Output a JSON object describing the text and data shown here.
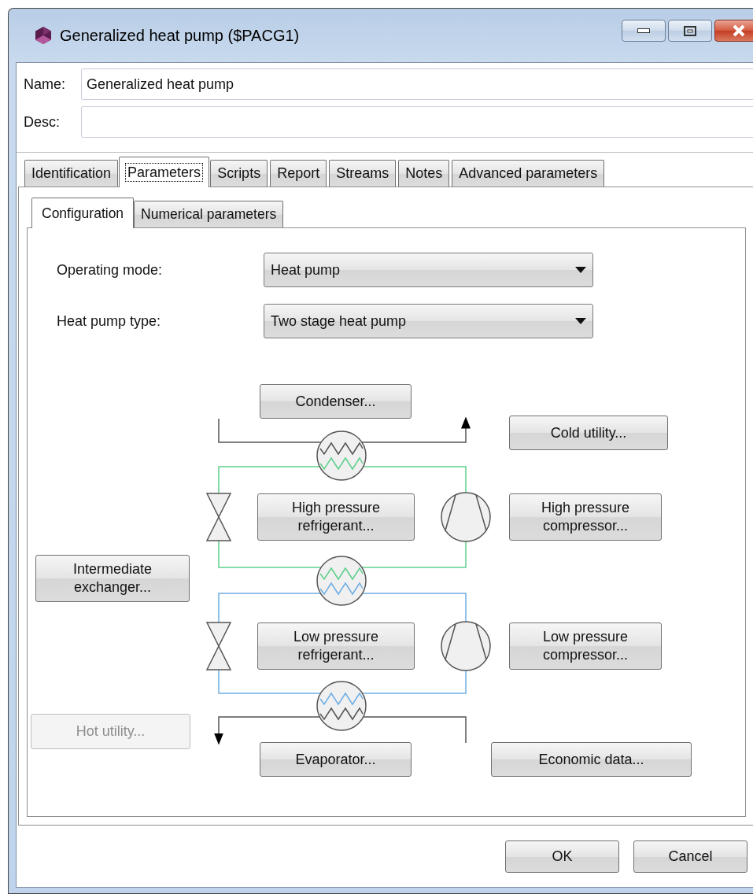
{
  "window": {
    "title": "Generalized heat pump ($PACG1)"
  },
  "fields": [
    {
      "label": "Name:",
      "value": "Generalized heat pump"
    },
    {
      "label": "Desc:"
    }
  ],
  "tabs": [
    {
      "label": "Identification",
      "selected": false
    },
    {
      "label": "Parameters",
      "selected": true
    },
    {
      "label": "Scripts",
      "selected": false
    },
    {
      "label": "Report",
      "selected": false
    },
    {
      "label": "Streams",
      "selected": false
    },
    {
      "label": "Notes",
      "selected": false
    },
    {
      "label": "Advanced parameters",
      "selected": false
    }
  ],
  "subtabs": [
    {
      "label": "Configuration",
      "selected": true
    },
    {
      "label": "Numerical parameters",
      "selected": false
    }
  ],
  "settings": [
    {
      "label": "Operating mode:",
      "value": "Heat pump"
    },
    {
      "label": "Heat pump type:",
      "value": "Two stage heat pump"
    }
  ],
  "diagram": {
    "buttons": [
      {
        "label": "Condenser...",
        "disabled": false
      },
      {
        "label": "Cold utility...",
        "disabled": false
      },
      {
        "label": "High pressure refrigerant...",
        "disabled": false
      },
      {
        "label": "High pressure compressor...",
        "disabled": false
      },
      {
        "label": "Intermediate exchanger...",
        "disabled": false
      },
      {
        "label": "Low pressure refrigerant...",
        "disabled": false
      },
      {
        "label": "Low pressure compressor...",
        "disabled": false
      },
      {
        "label": "Hot utility...",
        "disabled": true
      },
      {
        "label": "Evaporator...",
        "disabled": false
      },
      {
        "label": "Economic data...",
        "disabled": false
      }
    ]
  },
  "buttons": [
    "OK",
    "Cancel"
  ]
}
